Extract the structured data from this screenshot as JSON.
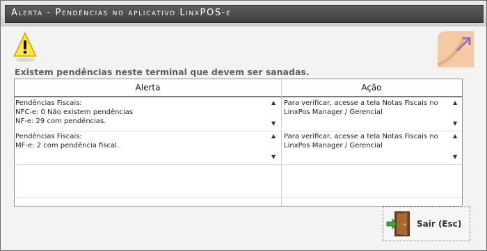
{
  "window": {
    "title": "Alerta - Pendências no aplicativo LinxPOS-e"
  },
  "icons": {
    "warning": "warning-icon",
    "corner": "expand-arrow-icon",
    "exit": "door-icon"
  },
  "message": "Existem pendências neste terminal que devem ser sanadas.",
  "grid": {
    "columns": [
      "Alerta",
      "Ação"
    ],
    "rows": [
      {
        "alerta": "Pendências Fiscais:\nNFC-e: 0 Não existem pendências\nNF-e: 29 com pendências.",
        "acao": "Para verificar, acesse a tela Notas Fiscais no LinxPos Manager / Gerencial"
      },
      {
        "alerta": "Pendências Fiscais:\nMF-e: 2 com pendência fiscal.",
        "acao": "Para verificar, acesse a tela Notas Fiscais no LinxPos Manager / Gerencial"
      }
    ]
  },
  "exit_button": {
    "label": "Sair (Esc)"
  },
  "colors": {
    "title_bar": "#4a4a4a",
    "warning_yellow": "#f2d400",
    "corner_peach": "#f4c9a4",
    "corner_purple": "#8a74c4"
  }
}
